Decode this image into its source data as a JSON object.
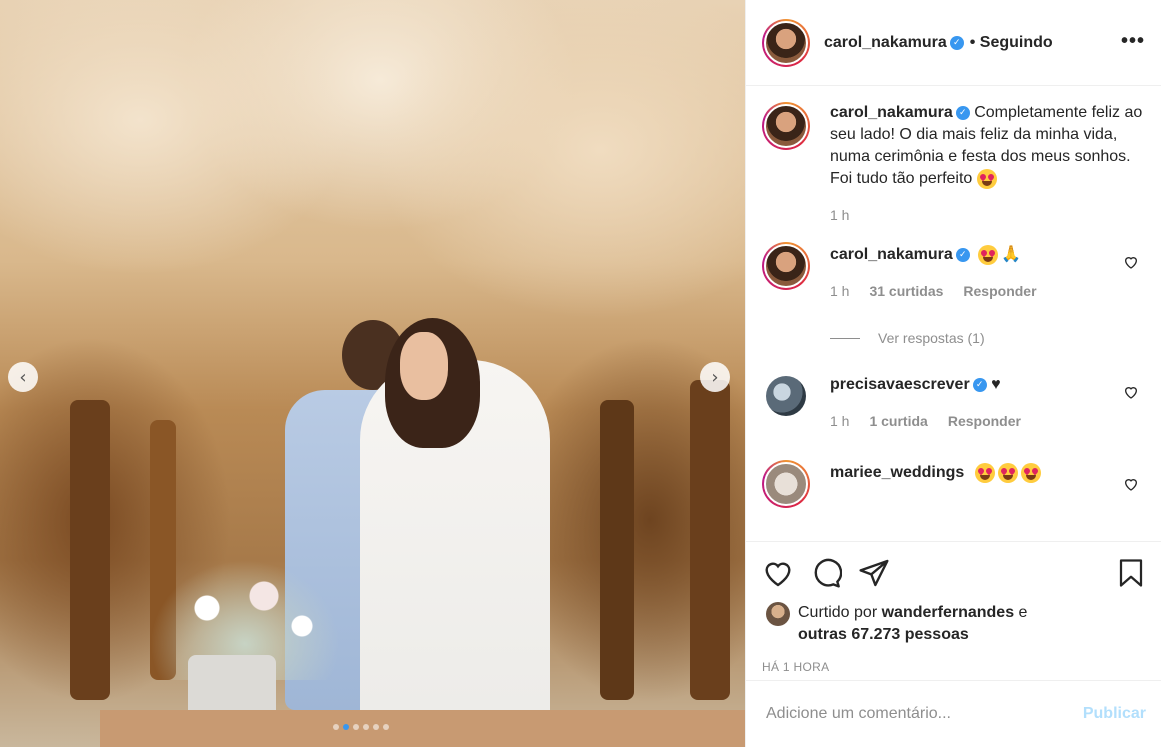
{
  "post": {
    "author": "carol_nakamura",
    "follow_status": "• Seguindo",
    "more_label": "•••",
    "carousel": {
      "prev": "‹",
      "next": "›",
      "slides": 6,
      "active_slide": 2
    }
  },
  "caption": {
    "username": "carol_nakamura",
    "text": "Completamente feliz ao seu lado! O dia mais feliz da minha vida, numa cerimônia e festa dos meus sonhos. Foi tudo tão perfeito",
    "time": "1 h"
  },
  "comments": [
    {
      "username": "carol_nakamura",
      "verified": true,
      "text": "🙏",
      "emojis": 1,
      "time": "1 h",
      "likes": "31 curtidas",
      "reply": "Responder",
      "view_replies": "Ver respostas (1)"
    },
    {
      "username": "precisavaescrever",
      "verified": true,
      "text": "♥",
      "emojis": 0,
      "time": "1 h",
      "likes": "1 curtida",
      "reply": "Responder"
    },
    {
      "username": "mariee_weddings",
      "verified": false,
      "text": "",
      "emojis": 3
    }
  ],
  "likes": {
    "prefix": "Curtido por",
    "user": "wanderfernandes",
    "connector": "e",
    "others": "outras 67.273 pessoas"
  },
  "timestamp": "HÁ 1 HORA",
  "comment_box": {
    "placeholder": "Adicione um comentário...",
    "submit": "Publicar"
  },
  "colors": {
    "verified": "#3897f0",
    "publish": "#b2dffc",
    "muted": "#8e8e8e"
  }
}
